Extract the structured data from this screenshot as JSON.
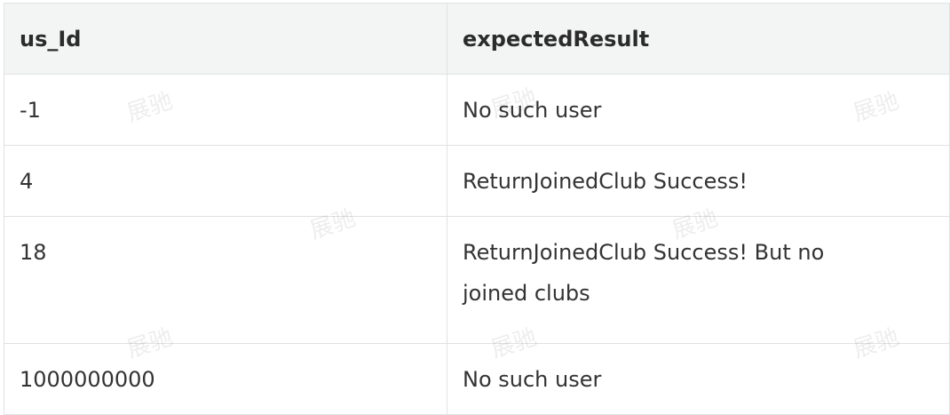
{
  "table": {
    "headers": [
      "us_Id",
      "expectedResult"
    ],
    "rows": [
      [
        "-1",
        "No such user"
      ],
      [
        "4",
        "ReturnJoinedClub Success!"
      ],
      [
        "18",
        "ReturnJoinedClub Success! But no joined clubs"
      ],
      [
        "1000000000",
        "No such user"
      ]
    ]
  },
  "watermark": "展驰"
}
